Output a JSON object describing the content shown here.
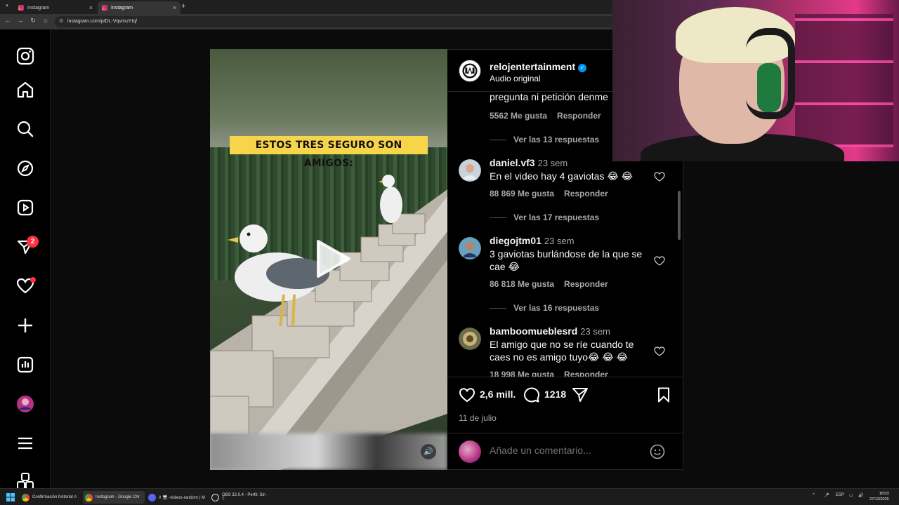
{
  "browser": {
    "tabs": [
      {
        "title": "Instagram"
      },
      {
        "title": "Instagram"
      }
    ],
    "url": "instagram.com/p/DL-VqvmuYIq/"
  },
  "sidenav": {
    "items": [
      "instagram-logo",
      "home",
      "search",
      "explore",
      "reels",
      "messages",
      "notifications",
      "create",
      "dashboard",
      "profile",
      "more",
      "also-from-meta"
    ],
    "messages_badge": "2"
  },
  "post": {
    "username": "relojentertainment",
    "audio": "Audio original",
    "overlay_text": "ESTOS TRES SEGURO SON AMIGOS:",
    "likes": "2,6 mill.",
    "comments_count": "1218",
    "date": "11 de julio",
    "comment_placeholder": "Añade un comentario..."
  },
  "comments": [
    {
      "text": "pregunta ni petición denme",
      "likes": "5562 Me gusta",
      "reply": "Responder",
      "view_replies": "Ver las 13 respuestas"
    },
    {
      "user": "daniel.vf3",
      "time": "23 sem",
      "text": "En el video hay 4 gaviotas 😂 😂",
      "likes": "88 869 Me gusta",
      "reply": "Responder",
      "view_replies": "Ver las 17 respuestas"
    },
    {
      "user": "diegojtm01",
      "time": "23 sem",
      "text": "3 gaviotas burlándose de la que se cae 😂",
      "likes": "86 818 Me gusta",
      "reply": "Responder",
      "view_replies": "Ver las 16 respuestas"
    },
    {
      "user": "bamboomueblesrd",
      "time": "23 sem",
      "text": "El amigo que no se ríe cuando te caes no es amigo tuyo😂 😂 😂",
      "likes": "18 998 Me gusta",
      "reply": "Responder"
    }
  ],
  "taskbar": {
    "items": [
      "Confirmación historial n",
      "Instagram - Google Chr",
      "# 🖥 -videos-random | M",
      "OBS 32.0.4 - Perfil: Sin T"
    ],
    "lang": "ESP",
    "time": "18:03",
    "date": "27/12/2025"
  },
  "colors": {
    "background": "#0b0b0b",
    "text": "#f5f5f5",
    "muted": "#a8a8a8",
    "verified": "#0095f6",
    "badge": "#ff3040",
    "banner": "#f7d54a"
  }
}
